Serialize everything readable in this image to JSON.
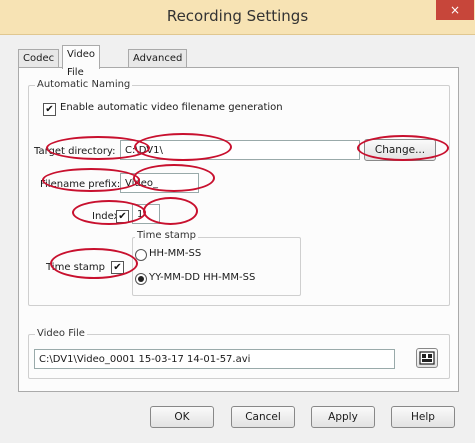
{
  "window": {
    "title": "Recording Settings",
    "close_glyph": "×"
  },
  "tabs": [
    {
      "label": "Codec"
    },
    {
      "label": "Video File",
      "active": true
    },
    {
      "label": "Advanced"
    }
  ],
  "automatic_naming": {
    "legend": "Automatic Naming",
    "enable_label": "Enable automatic video filename generation",
    "enable_checked": true,
    "target_directory_label": "Target directory:",
    "target_directory_value": "C:\\DV1\\",
    "change_button": "Change...",
    "filename_prefix_label": "Filename prefix:",
    "filename_prefix_value": "Video_",
    "index_label": "Index",
    "index_checked": true,
    "index_value": "1",
    "time_stamp_label": "Time stamp",
    "time_stamp_checked": true,
    "time_stamp_group": {
      "legend": "Time stamp",
      "options": [
        {
          "label": "HH-MM-SS",
          "selected": false
        },
        {
          "label": "YY-MM-DD HH-MM-SS",
          "selected": true
        }
      ]
    }
  },
  "video_file": {
    "legend": "Video File",
    "path_value": "C:\\DV1\\Video_0001 15-03-17 14-01-57.avi",
    "browse_icon": "folder-browse-icon"
  },
  "footer": {
    "ok": "OK",
    "cancel": "Cancel",
    "apply": "Apply",
    "help": "Help"
  },
  "colors": {
    "annotation": "#c8102e",
    "titlebar": "#f7e3b4",
    "close": "#c7463a"
  }
}
